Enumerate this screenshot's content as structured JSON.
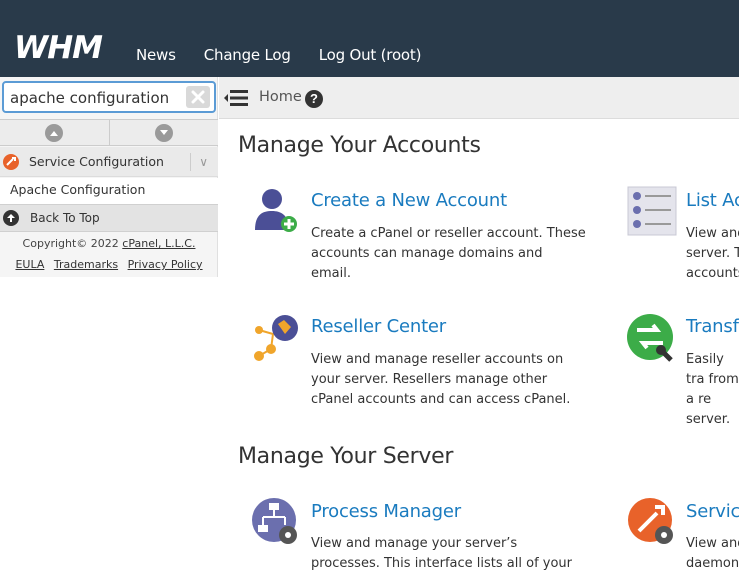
{
  "header": {
    "logo_text": "WHM",
    "nav": [
      "News",
      "Change Log",
      "Log Out (root)"
    ]
  },
  "search": {
    "value": "apache configuration"
  },
  "sidebar": {
    "category": "Service Configuration",
    "item": "Apache Configuration",
    "back_to_top": "Back To Top",
    "copyright_prefix": "Copyright© 2022 ",
    "copyright_link": "cPanel, L.L.C.",
    "footer_links": [
      "EULA",
      "Trademarks",
      "Privacy Policy"
    ]
  },
  "breadcrumb": {
    "home": "Home",
    "help": "?"
  },
  "sections": [
    {
      "title": "Manage Your Accounts",
      "items": [
        {
          "title": "Create a New Account",
          "desc": "Create a cPanel or reseller account. These accounts can manage domains and email.",
          "icon": "add-user-icon"
        },
        {
          "title": "List Ac",
          "desc": "View and server. T accounts",
          "icon": "list-accounts-icon"
        },
        {
          "title": "Reseller Center",
          "desc": "View and manage reseller accounts on your server. Resellers manage other cPanel accounts and can access cPanel.",
          "icon": "reseller-icon"
        },
        {
          "title": "Transf",
          "desc": "Easily tra from a re server.",
          "icon": "transfer-icon"
        }
      ]
    },
    {
      "title": "Manage Your Server",
      "items": [
        {
          "title": "Process Manager",
          "desc": "View and manage your server’s processes. This interface lists all of your server’s running",
          "icon": "process-manager-icon"
        },
        {
          "title": "Service",
          "desc": "View and daemons",
          "icon": "service-manager-icon"
        }
      ]
    }
  ],
  "colors": {
    "header_bg": "#293a4a",
    "link_blue": "#1a7bbf",
    "green": "#3cac48",
    "orange": "#f0a52b",
    "purple": "#4b4f96"
  }
}
